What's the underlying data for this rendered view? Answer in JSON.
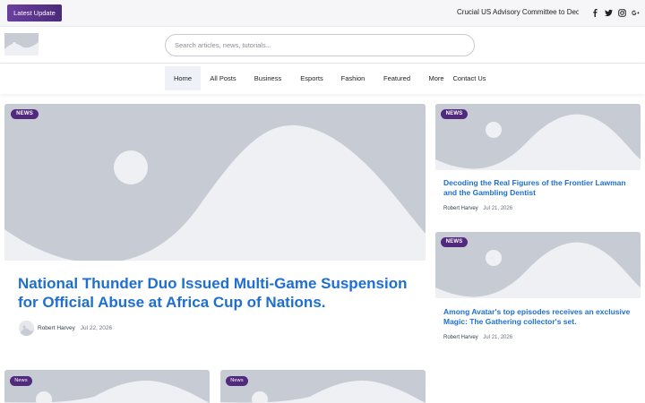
{
  "topbar": {
    "latest_label": "Latest Update",
    "ticker_text": "Crucial US Advisory Committee to Decide",
    "social": [
      "facebook-icon",
      "twitter-icon",
      "instagram-icon",
      "google-plus-icon"
    ]
  },
  "header": {
    "search_placeholder": "Search articles, news, tutorials..."
  },
  "nav": {
    "items": [
      "Home",
      "All Posts",
      "Business",
      "Esports",
      "Fashion",
      "Featured",
      "More",
      "Contact Us"
    ],
    "active": "Home"
  },
  "featured": {
    "badge": "NEWS",
    "title": "National Thunder Duo Issued Multi-Game Suspension for Official Abuse at Africa Cup of Nations.",
    "author": "Robert Harvey",
    "date": "Jul 22, 2026"
  },
  "side_posts": [
    {
      "badge": "NEWS",
      "title": "Decoding the Real Figures of the Frontier Lawman and the Gambling Dentist",
      "author": "Robert Harvey",
      "date": "Jul 21, 2026"
    },
    {
      "badge": "NEWS",
      "title": "Among Avatar's top episodes receives an exclusive Magic: The Gathering collector's set.",
      "author": "Robert Harvey",
      "date": "Jul 21, 2026"
    }
  ],
  "bottom_posts": [
    {
      "badge": "News"
    },
    {
      "badge": "News"
    }
  ],
  "colors": {
    "accent": "#512a7e",
    "title_blue": "#1e6fd0",
    "placeholder_gray": "#c7ccd4"
  }
}
